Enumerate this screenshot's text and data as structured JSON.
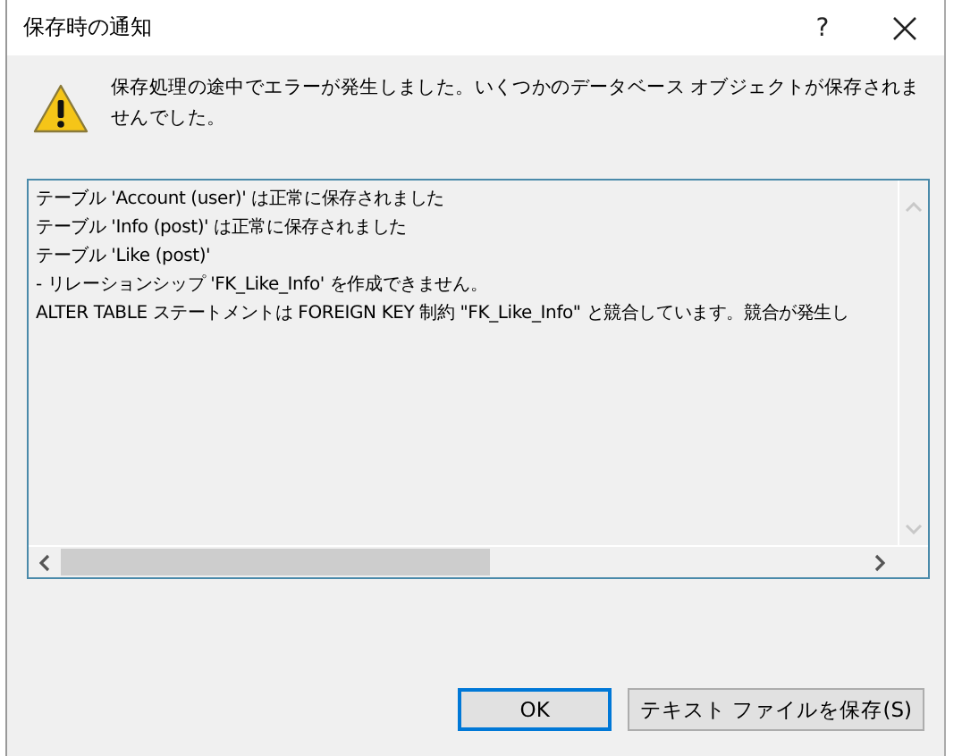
{
  "window": {
    "title": "保存時の通知",
    "help": "?"
  },
  "message": "保存処理の途中でエラーが発生しました。いくつかのデータベース オブジェクトが保存されませんでした。",
  "log_lines": [
    "テーブル 'Account (user)' は正常に保存されました",
    "テーブル 'Info (post)' は正常に保存されました",
    "テーブル 'Like (post)'",
    "- リレーションシップ 'FK_Like_Info' を作成できません。",
    "ALTER TABLE ステートメントは FOREIGN KEY 制約 \"FK_Like_Info\" と競合しています。競合が発生し"
  ],
  "buttons": [
    {
      "label": "OK",
      "default": true
    },
    {
      "label": "テキスト ファイルを保存(S)",
      "default": false
    }
  ]
}
